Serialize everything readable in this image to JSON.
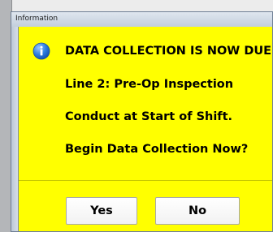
{
  "window": {
    "title": "Information",
    "client_background": "#ffff00"
  },
  "message": {
    "icon": "info-icon",
    "lines": [
      "DATA COLLECTION IS NOW DUE!",
      "Line 2: Pre-Op Inspection",
      "Conduct at Start of Shift.",
      "Begin Data Collection Now?"
    ]
  },
  "buttons": {
    "yes_label": "Yes",
    "no_label": "No"
  }
}
